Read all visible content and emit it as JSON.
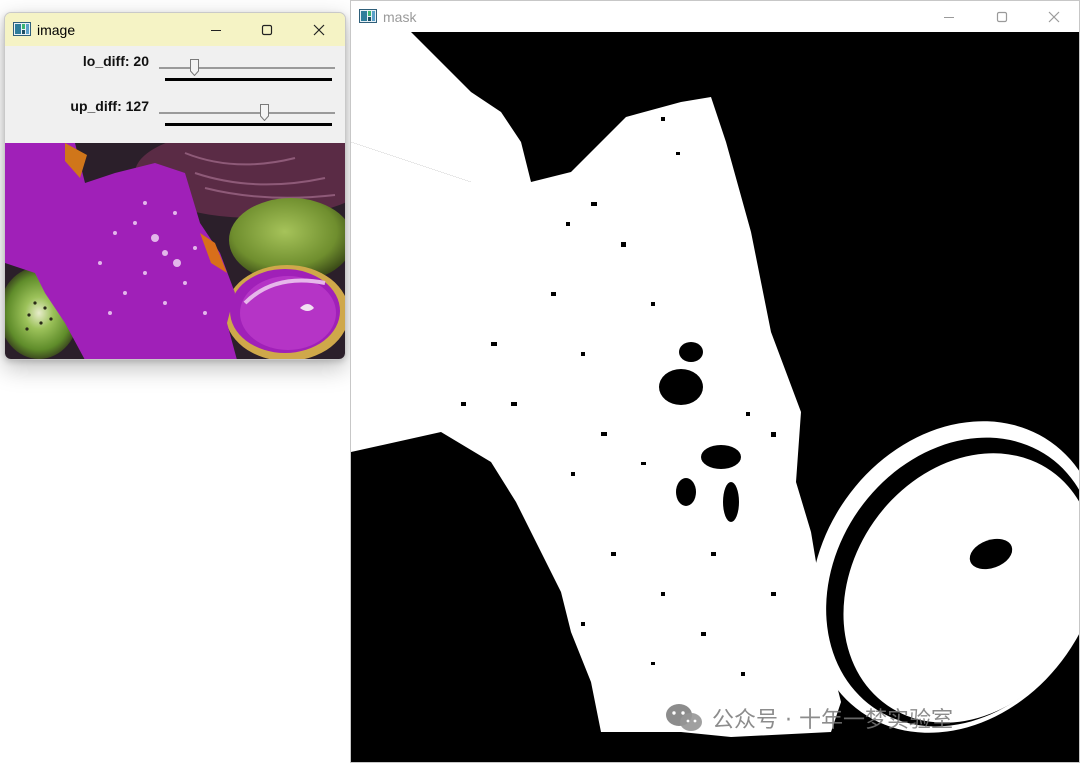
{
  "image_window": {
    "title": "image",
    "trackbars": [
      {
        "label": "lo_diff: 20",
        "name": "lo_diff",
        "value": 20,
        "max": 255
      },
      {
        "label": "up_diff: 127",
        "name": "up_diff",
        "value": 127,
        "max": 255
      }
    ]
  },
  "mask_window": {
    "title": "mask"
  },
  "watermark": {
    "text": "公众号 · 十年一梦实验室"
  },
  "colors": {
    "image_titlebar": "#f5f3c5",
    "fill_magenta": "#a020b8",
    "mask_foreground": "#ffffff",
    "mask_background": "#000000"
  },
  "icons": [
    "opencv-window-icon",
    "minimize-icon",
    "maximize-icon",
    "close-icon",
    "wechat-icon"
  ]
}
